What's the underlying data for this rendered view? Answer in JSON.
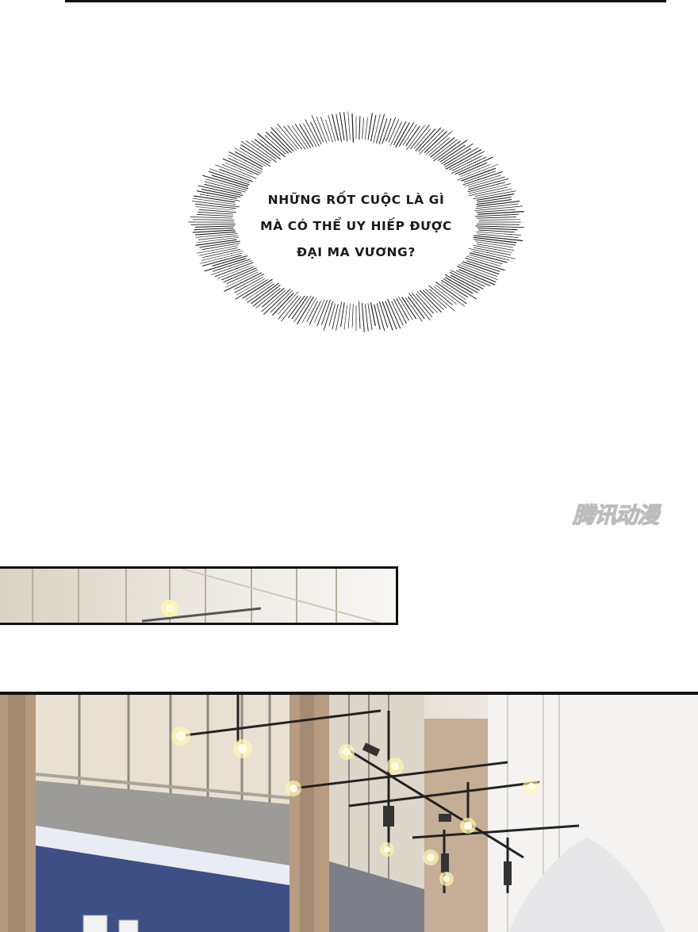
{
  "speech_bubble": {
    "lines": [
      "NHỮNG RỐT CUỘC LÀ GÌ",
      "MÀ CÓ THỂ UY HIẾP ĐƯỢC",
      "ĐẠI MA VƯƠNG?"
    ]
  },
  "watermark": {
    "text": "腾讯动漫"
  },
  "colors": {
    "ink": "#111111",
    "lamp": "#fff6b0",
    "wall": "#d9cdbb",
    "floor_blue": "#3e4f86"
  }
}
